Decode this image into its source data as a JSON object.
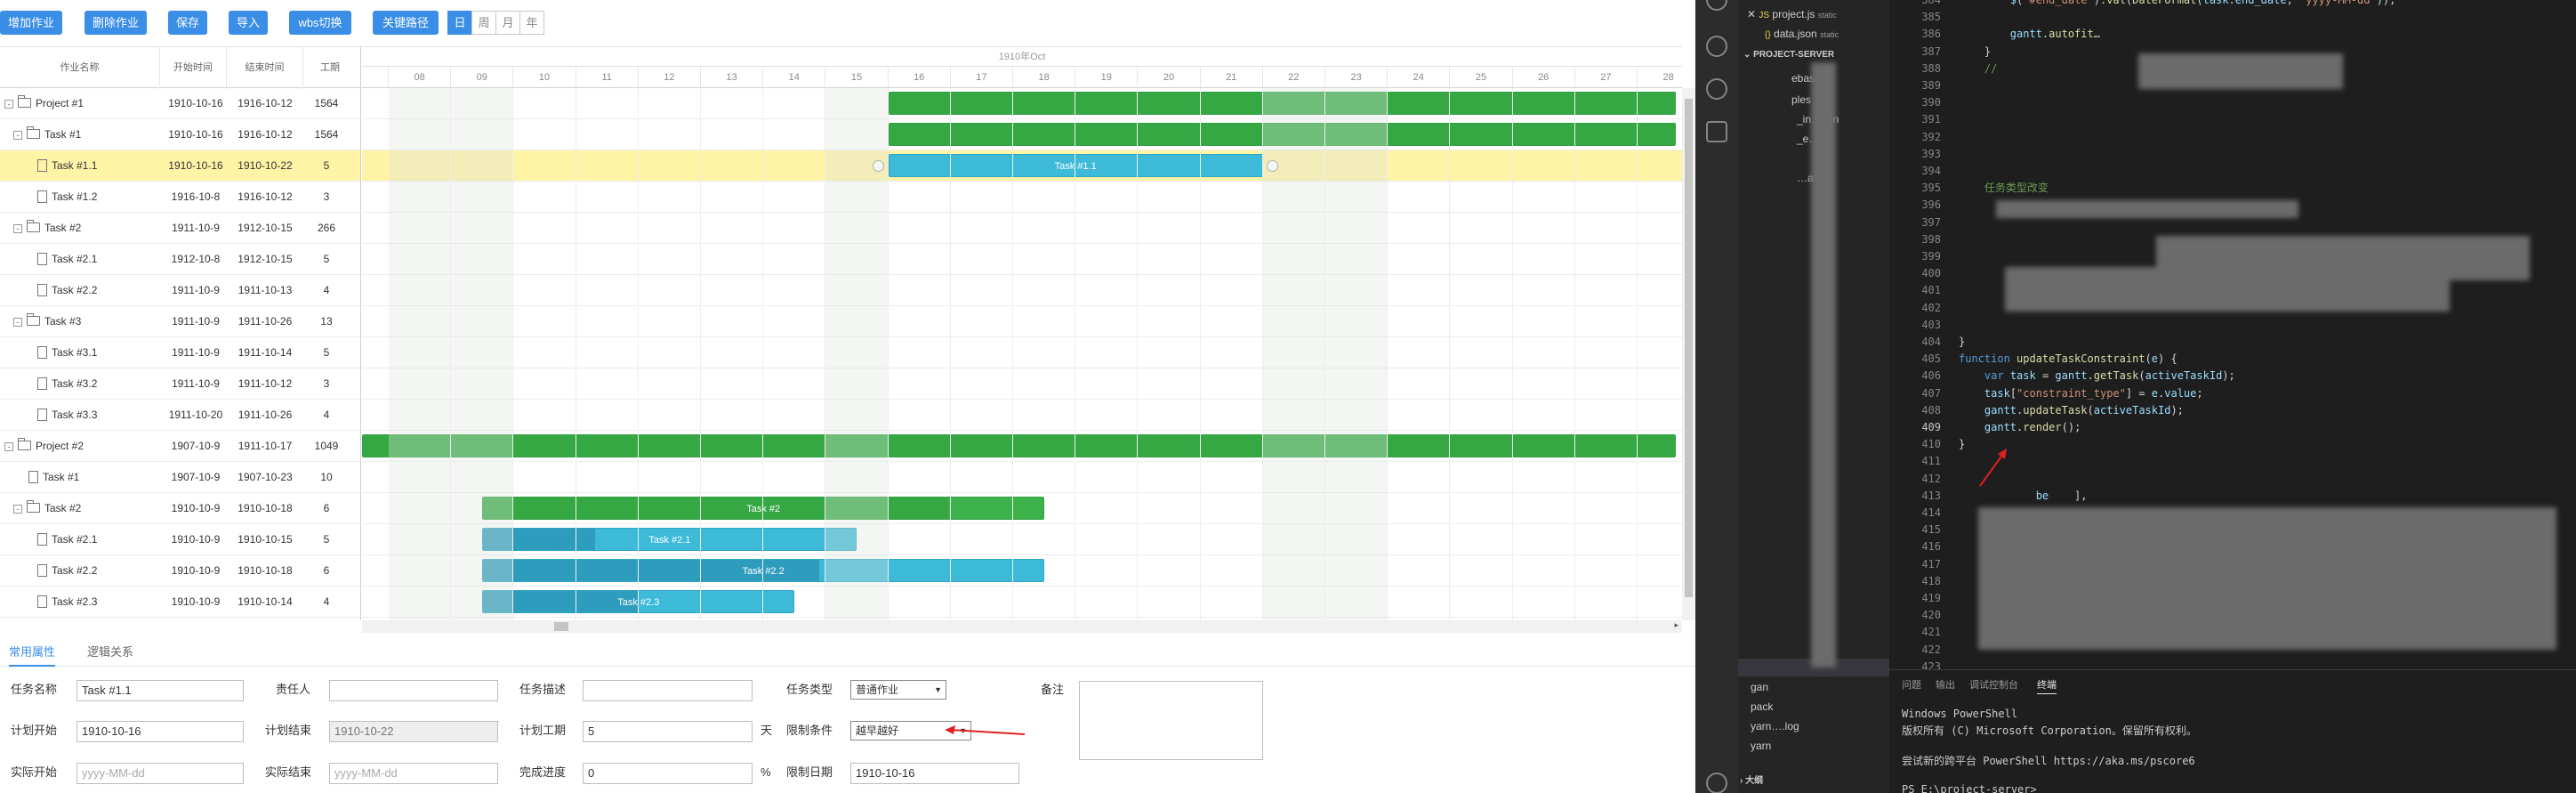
{
  "toolbar": {
    "buttons": [
      "增加作业",
      "删除作业",
      "保存",
      "导入",
      "wbs切换",
      "关键路径"
    ],
    "scale": [
      "日",
      "周",
      "月",
      "年"
    ],
    "active_scale": "日"
  },
  "grid": {
    "headers": [
      "作业名称",
      "开始时间",
      "结束时间",
      "工期"
    ],
    "rows": [
      {
        "name": "Project #1",
        "start": "1910-10-16",
        "end": "1916-10-12",
        "dur": "1564",
        "lvl": 0,
        "type": "folder",
        "tog": "-"
      },
      {
        "name": "Task #1",
        "start": "1910-10-16",
        "end": "1916-10-12",
        "dur": "1564",
        "lvl": 1,
        "type": "folder",
        "tog": "-"
      },
      {
        "name": "Task #1.1",
        "start": "1910-10-16",
        "end": "1910-10-22",
        "dur": "5",
        "lvl": 2,
        "type": "file",
        "tog": "",
        "sel": true
      },
      {
        "name": "Task #1.2",
        "start": "1916-10-8",
        "end": "1916-10-12",
        "dur": "3",
        "lvl": 2,
        "type": "file",
        "tog": ""
      },
      {
        "name": "Task #2",
        "start": "1911-10-9",
        "end": "1912-10-15",
        "dur": "266",
        "lvl": 1,
        "type": "folder",
        "tog": "-"
      },
      {
        "name": "Task #2.1",
        "start": "1912-10-8",
        "end": "1912-10-15",
        "dur": "5",
        "lvl": 2,
        "type": "file",
        "tog": ""
      },
      {
        "name": "Task #2.2",
        "start": "1911-10-9",
        "end": "1911-10-13",
        "dur": "4",
        "lvl": 2,
        "type": "file",
        "tog": ""
      },
      {
        "name": "Task #3",
        "start": "1911-10-9",
        "end": "1911-10-26",
        "dur": "13",
        "lvl": 1,
        "type": "folder",
        "tog": "-"
      },
      {
        "name": "Task #3.1",
        "start": "1911-10-9",
        "end": "1911-10-14",
        "dur": "5",
        "lvl": 2,
        "type": "file",
        "tog": ""
      },
      {
        "name": "Task #3.2",
        "start": "1911-10-9",
        "end": "1911-10-12",
        "dur": "3",
        "lvl": 2,
        "type": "file",
        "tog": ""
      },
      {
        "name": "Task #3.3",
        "start": "1911-10-20",
        "end": "1911-10-26",
        "dur": "4",
        "lvl": 2,
        "type": "file",
        "tog": ""
      },
      {
        "name": "Project #2",
        "start": "1907-10-9",
        "end": "1911-10-17",
        "dur": "1049",
        "lvl": 0,
        "type": "folder",
        "tog": "-"
      },
      {
        "name": "Task #1",
        "start": "1907-10-9",
        "end": "1907-10-23",
        "dur": "10",
        "lvl": 1,
        "type": "file",
        "tog": ""
      },
      {
        "name": "Task #2",
        "start": "1910-10-9",
        "end": "1910-10-18",
        "dur": "6",
        "lvl": 1,
        "type": "folder",
        "tog": "-"
      },
      {
        "name": "Task #2.1",
        "start": "1910-10-9",
        "end": "1910-10-15",
        "dur": "5",
        "lvl": 2,
        "type": "file",
        "tog": ""
      },
      {
        "name": "Task #2.2",
        "start": "1910-10-9",
        "end": "1910-10-18",
        "dur": "6",
        "lvl": 2,
        "type": "file",
        "tog": ""
      },
      {
        "name": "Task #2.3",
        "start": "1910-10-9",
        "end": "1910-10-14",
        "dur": "4",
        "lvl": 2,
        "type": "file",
        "tog": ""
      }
    ]
  },
  "timeline": {
    "month": "1910年Oct",
    "days": [
      "08",
      "09",
      "10",
      "11",
      "12",
      "13",
      "14",
      "15",
      "16",
      "17",
      "18",
      "19",
      "20",
      "21",
      "22",
      "23",
      "24",
      "25",
      "26",
      "27",
      "28"
    ]
  },
  "bars": [
    {
      "row": 0,
      "text": "",
      "from": "16",
      "to": "end",
      "progress": 1,
      "color": "green"
    },
    {
      "row": 1,
      "text": "",
      "from": "16",
      "to": "end",
      "progress": 1,
      "color": "green"
    },
    {
      "row": 2,
      "text": "Task #1.1",
      "from": "16",
      "to": "22",
      "progress": 0,
      "color": "blue"
    },
    {
      "row": 11,
      "text": "",
      "from": "start",
      "to": "end",
      "progress": 1,
      "color": "green"
    },
    {
      "row": 13,
      "text": "Task #2",
      "from": "09.5",
      "to": "18.5",
      "progress": 0.83,
      "color": "green"
    },
    {
      "row": 14,
      "text": "Task #2.1",
      "from": "09.5",
      "to": "15.5",
      "progress": 0.3,
      "color": "blue"
    },
    {
      "row": 15,
      "text": "Task #2.2",
      "from": "09.5",
      "to": "18.5",
      "progress": 0.6,
      "color": "blue"
    },
    {
      "row": 16,
      "text": "Task #2.3",
      "from": "09.5",
      "to": "14.5",
      "progress": 0.5,
      "color": "blue"
    }
  ],
  "form": {
    "tabs": [
      "常用属性",
      "逻辑关系"
    ],
    "task_name_label": "任务名称",
    "task_name": "Task #1.1",
    "owner_label": "责任人",
    "owner": "",
    "desc_label": "任务描述",
    "desc": "",
    "type_label": "任务类型",
    "type": "普通作业",
    "note_label": "备注",
    "plan_start_label": "计划开始",
    "plan_start": "1910-10-16",
    "plan_end_label": "计划结束",
    "plan_end": "1910-10-22",
    "plan_dur_label": "计划工期",
    "plan_dur": "5",
    "plan_dur_unit": "天",
    "constraint_label": "限制条件",
    "constraint": "越早越好",
    "act_start_label": "实际开始",
    "act_start_ph": "yyyy-MM-dd",
    "act_end_label": "实际结束",
    "act_end_ph": "yyyy-MM-dd",
    "progress_label": "完成进度",
    "progress": "0",
    "progress_unit": "%",
    "limit_date_label": "限制日期",
    "limit_date": "1910-10-16"
  },
  "editor": {
    "explorer": {
      "files": [
        {
          "name": "project.js",
          "tag": "static",
          "icon": "JS"
        },
        {
          "name": "data.json",
          "tag": "static",
          "icon": "{}"
        }
      ],
      "section": "PROJECT-SERVER",
      "items": [
        "ebase",
        "ples",
        "_in…tion",
        "_e…s",
        "…ation",
        "gan",
        "pack",
        "yarn….log",
        "yarn"
      ],
      "outline": "大纲"
    },
    "lines": [
      {
        "n": "384",
        "html": "        <span class='vr'>$</span>(<span class='st'>\"#end_date\"</span>).<span class='fn'>val</span>(<span class='fn'>DateFormat</span>(<span class='vr'>task</span>.<span class='vr'>end_date</span>, <span class='st'>\"yyyy-MM-dd\"</span>));"
      },
      {
        "n": "385",
        "html": ""
      },
      {
        "n": "386",
        "html": "        <span class='vr'>gantt</span>.<span class='fn'>autofit</span>…"
      },
      {
        "n": "387",
        "html": "    }"
      },
      {
        "n": "388",
        "html": "    <span class='cm'>//</span>"
      },
      {
        "n": "389",
        "html": ""
      },
      {
        "n": "390",
        "html": ""
      },
      {
        "n": "391",
        "html": ""
      },
      {
        "n": "392",
        "html": ""
      },
      {
        "n": "393",
        "html": ""
      },
      {
        "n": "394",
        "html": ""
      },
      {
        "n": "395",
        "html": "    <span class='cm'>任务类型改变</span>"
      },
      {
        "n": "396",
        "html": ""
      },
      {
        "n": "397",
        "html": ""
      },
      {
        "n": "398",
        "html": ""
      },
      {
        "n": "399",
        "html": ""
      },
      {
        "n": "400",
        "html": ""
      },
      {
        "n": "401",
        "html": ""
      },
      {
        "n": "402",
        "html": ""
      },
      {
        "n": "403",
        "html": ""
      },
      {
        "n": "404",
        "html": "}"
      },
      {
        "n": "405",
        "html": "<span class='kw'>function</span> <span class='fn'>updateTaskConstraint</span>(<span class='vr'>e</span>) {"
      },
      {
        "n": "406",
        "html": "    <span class='kw'>var</span> <span class='vr'>task</span> = <span class='vr'>gantt</span>.<span class='fn'>getTask</span>(<span class='vr'>activeTaskId</span>);"
      },
      {
        "n": "407",
        "html": "    <span class='vr'>task</span>[<span class='st'>\"constraint_type\"</span>] = <span class='vr'>e</span>.<span class='vr'>value</span>;"
      },
      {
        "n": "408",
        "html": "    <span class='vr'>gantt</span>.<span class='fn'>updateTask</span>(<span class='vr'>activeTaskId</span>);"
      },
      {
        "n": "409",
        "html": "    <span class='vr'>gantt</span>.<span class='fn'>render</span>();"
      },
      {
        "n": "410",
        "html": "}"
      },
      {
        "n": "411",
        "html": ""
      },
      {
        "n": "412",
        "html": ""
      },
      {
        "n": "413",
        "html": "            <span class='vr'>be</span>    ],"
      },
      {
        "n": "414",
        "html": ""
      },
      {
        "n": "415",
        "html": "        },"
      },
      {
        "n": "416",
        "html": ""
      },
      {
        "n": "417",
        "html": ""
      },
      {
        "n": "418",
        "html": ""
      },
      {
        "n": "419",
        "html": ""
      },
      {
        "n": "420",
        "html": ""
      },
      {
        "n": "421",
        "html": ""
      },
      {
        "n": "422",
        "html": ""
      },
      {
        "n": "423",
        "html": ""
      }
    ],
    "current_line": "409",
    "terminal": {
      "tabs": [
        "问题",
        "输出",
        "调试控制台",
        "终端"
      ],
      "active": "终端",
      "lines": [
        "Windows PowerShell",
        "版权所有 (C) Microsoft Corporation。保留所有权利。",
        "",
        "尝试新的跨平台 PowerShell https://aka.ms/pscore6",
        "",
        "PS E:\\project-server>"
      ]
    }
  }
}
